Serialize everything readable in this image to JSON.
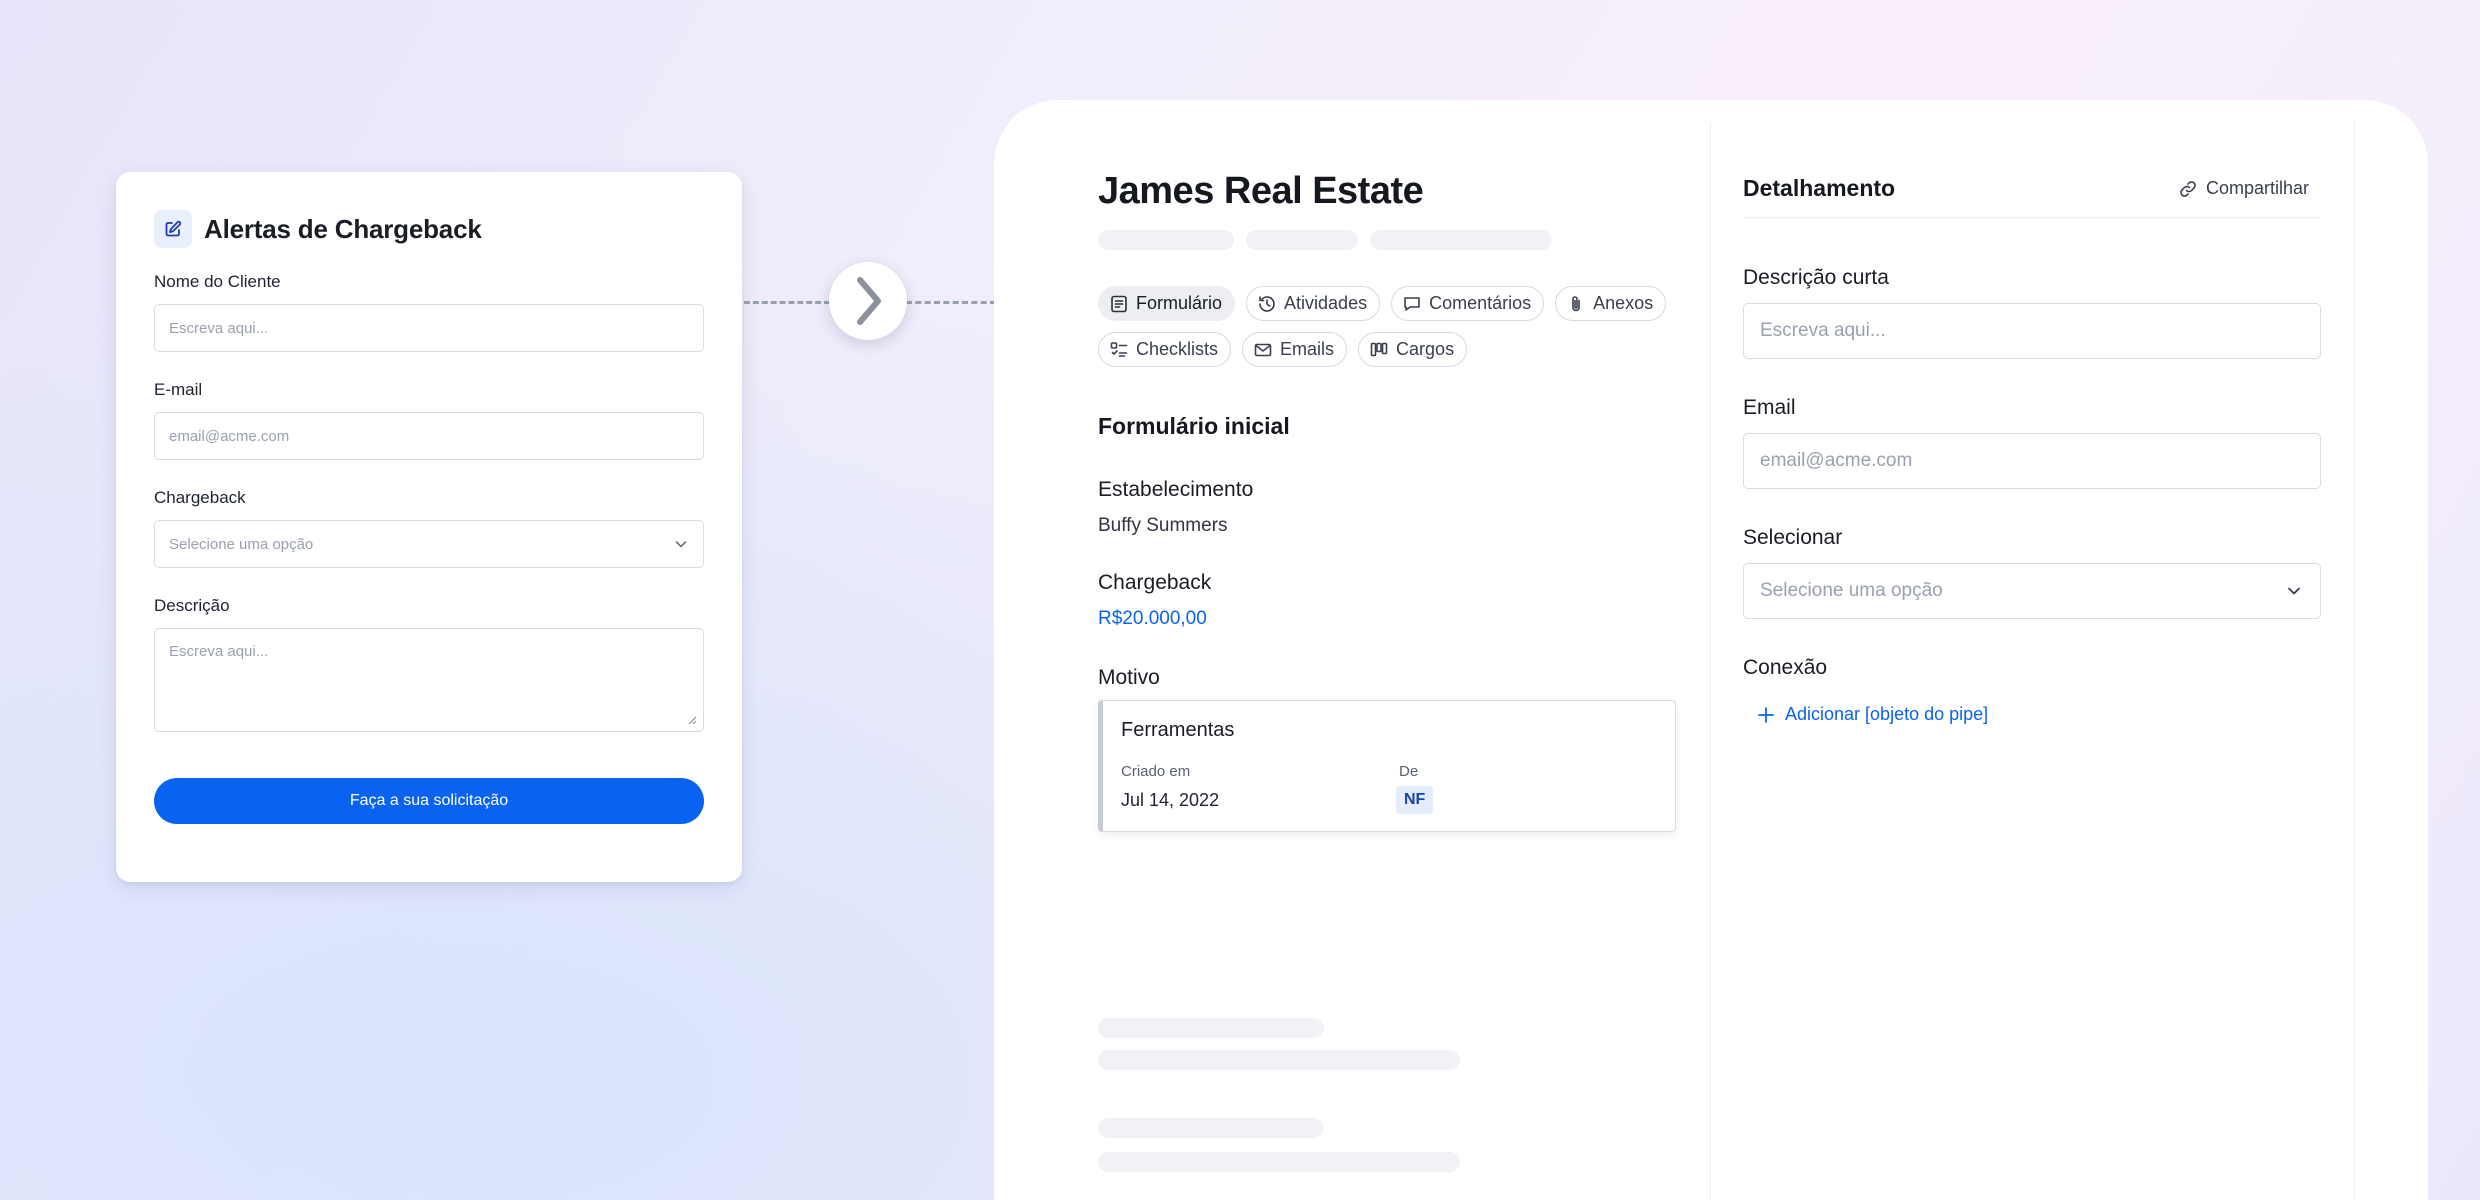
{
  "form": {
    "title": "Alertas de Chargeback",
    "fields": [
      {
        "label": "Nome do Cliente",
        "placeholder": "Escreva aqui..."
      },
      {
        "label": "E-mail",
        "placeholder": "email@acme.com"
      },
      {
        "label": "Chargeback",
        "placeholder": "Selecione uma opção"
      },
      {
        "label": "Descrição",
        "placeholder": "Escreva aqui..."
      }
    ],
    "submit_label": "Faça a sua solicitação"
  },
  "card": {
    "title": "James Real Estate",
    "tabs": [
      "Formulário",
      "Atividades",
      "Comentários",
      "Anexos",
      "Checklists",
      "Emails",
      "Cargos"
    ],
    "active_tab": "Formulário",
    "section_title": "Formulário inicial",
    "fields": [
      {
        "label": "Estabelecimento",
        "value": "Buffy Summers"
      },
      {
        "label": "Chargeback",
        "value": "R$20.000,00"
      }
    ],
    "motivo": {
      "label": "Motivo",
      "title": "Ferramentas",
      "created_label": "Criado em",
      "created_value": "Jul 14, 2022",
      "from_label": "De",
      "from_value": "NF"
    }
  },
  "detail": {
    "title": "Detalhamento",
    "share_label": "Compartilhar",
    "fields": [
      {
        "label": "Descrição curta",
        "placeholder": "Escreva aqui..."
      },
      {
        "label": "Email",
        "placeholder": "email@acme.com"
      },
      {
        "label": "Selecionar",
        "placeholder": "Selecione uma opção"
      }
    ],
    "connection_label": "Conexão",
    "add_link_label": "Adicionar [objeto do pipe]"
  },
  "colors": {
    "accent": "#0a63f0",
    "text": "#1a1d26",
    "border": "#d8dbe3",
    "skeleton": "#f1f2f5"
  }
}
